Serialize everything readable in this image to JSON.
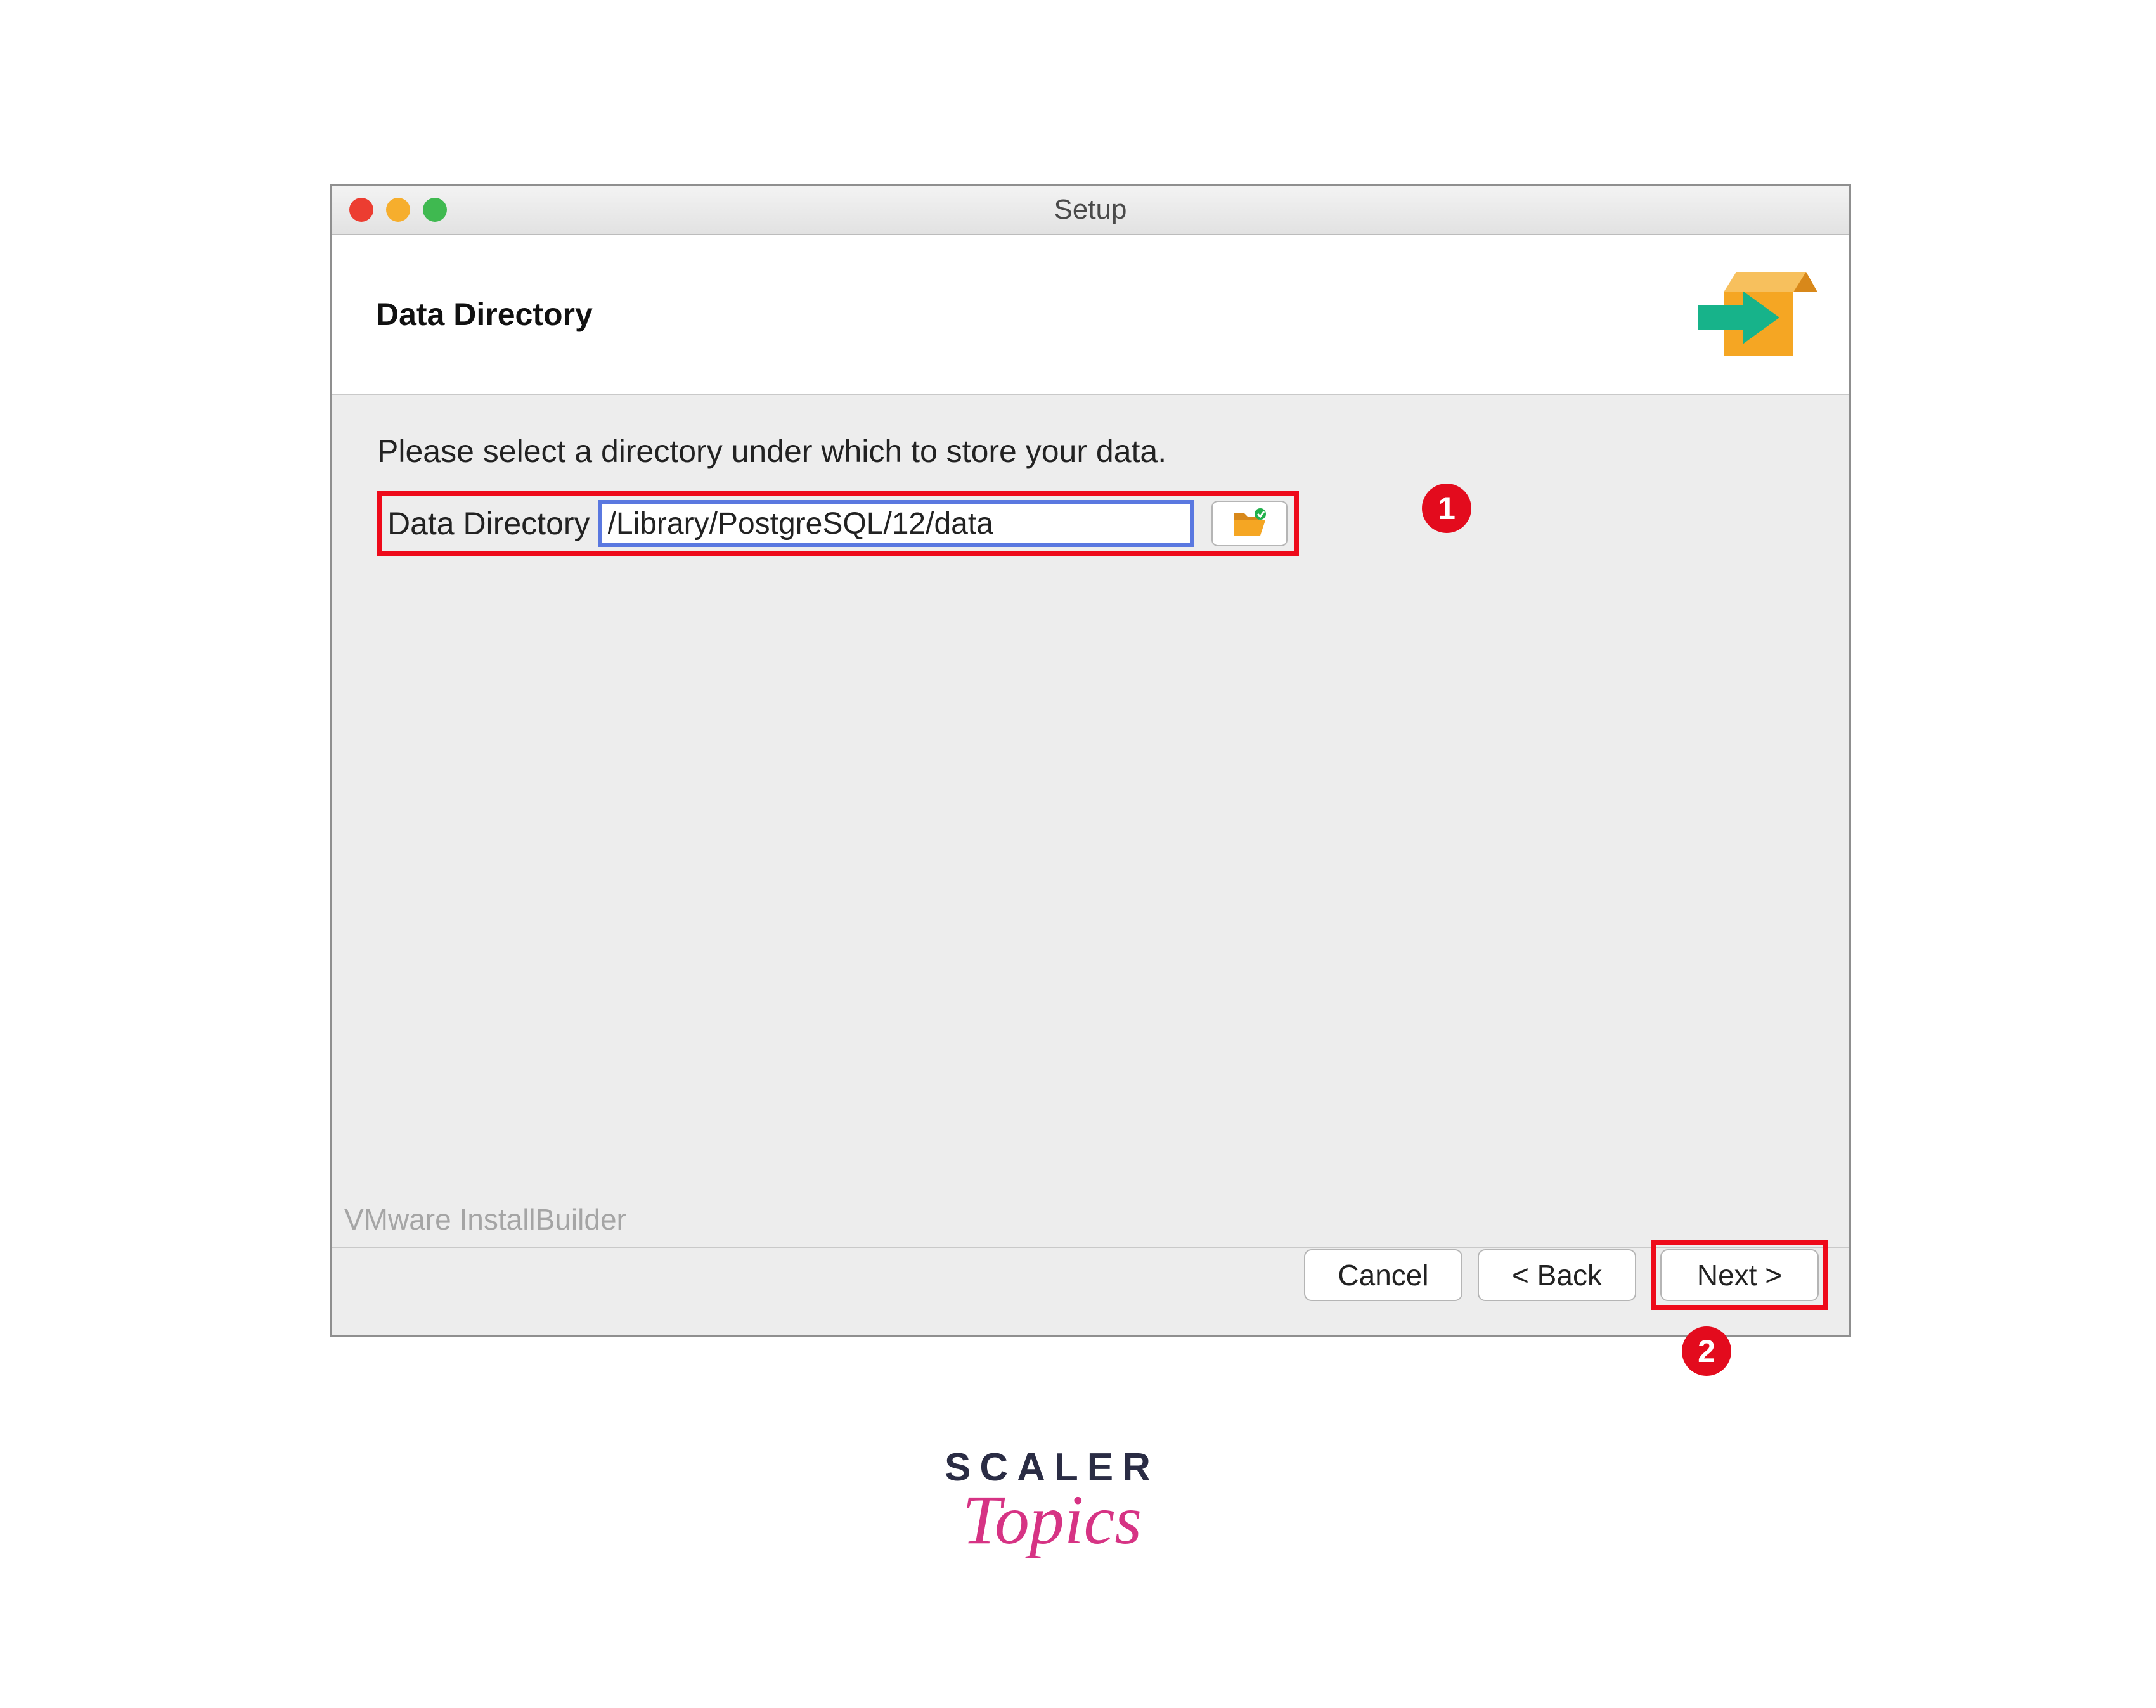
{
  "window": {
    "title": "Setup"
  },
  "header": {
    "title": "Data Directory"
  },
  "content": {
    "instruction": "Please select a directory under which to store your data.",
    "field_label": "Data Directory",
    "field_value": "/Library/PostgreSQL/12/data"
  },
  "callouts": {
    "one": "1",
    "two": "2"
  },
  "footer": {
    "brand": "VMware InstallBuilder",
    "cancel": "Cancel",
    "back": "< Back",
    "next": "Next >"
  },
  "brand_logo": {
    "line1": "SCALER",
    "line2": "Topics"
  },
  "icons": {
    "installer": "installer-box-icon",
    "browse": "folder-open-icon"
  }
}
